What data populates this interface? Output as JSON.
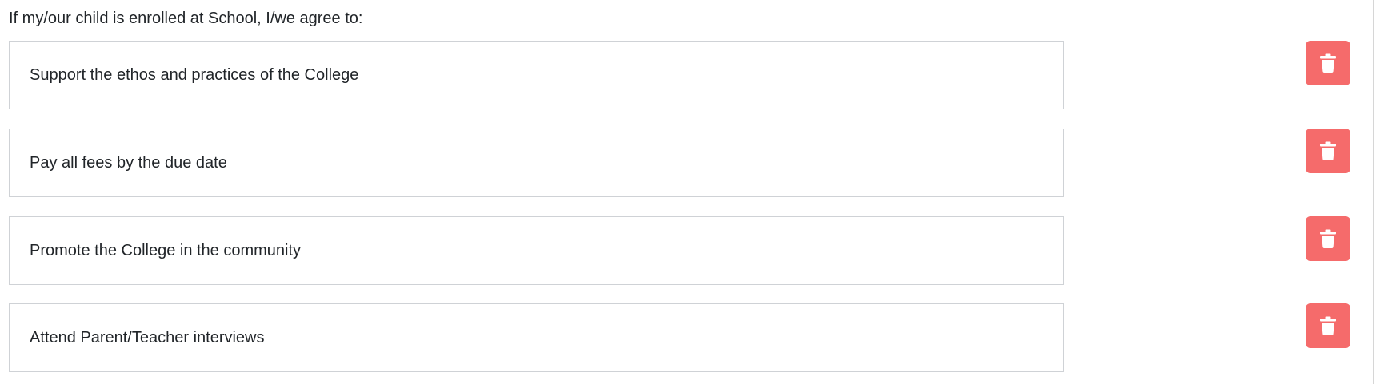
{
  "form": {
    "intro_text": "If my/our child is enrolled at School, I/we agree to:",
    "items": [
      {
        "value": "Support the ethos and practices of the College",
        "delete_icon": "trash-icon"
      },
      {
        "value": "Pay all fees by the due date",
        "delete_icon": "trash-icon"
      },
      {
        "value": "Promote the College in the community",
        "delete_icon": "trash-icon"
      },
      {
        "value": "Attend Parent/Teacher interviews",
        "delete_icon": "trash-icon"
      }
    ]
  },
  "colors": {
    "delete_button": "#f56b6b",
    "input_border": "#cfd2d6",
    "text": "#212529"
  }
}
